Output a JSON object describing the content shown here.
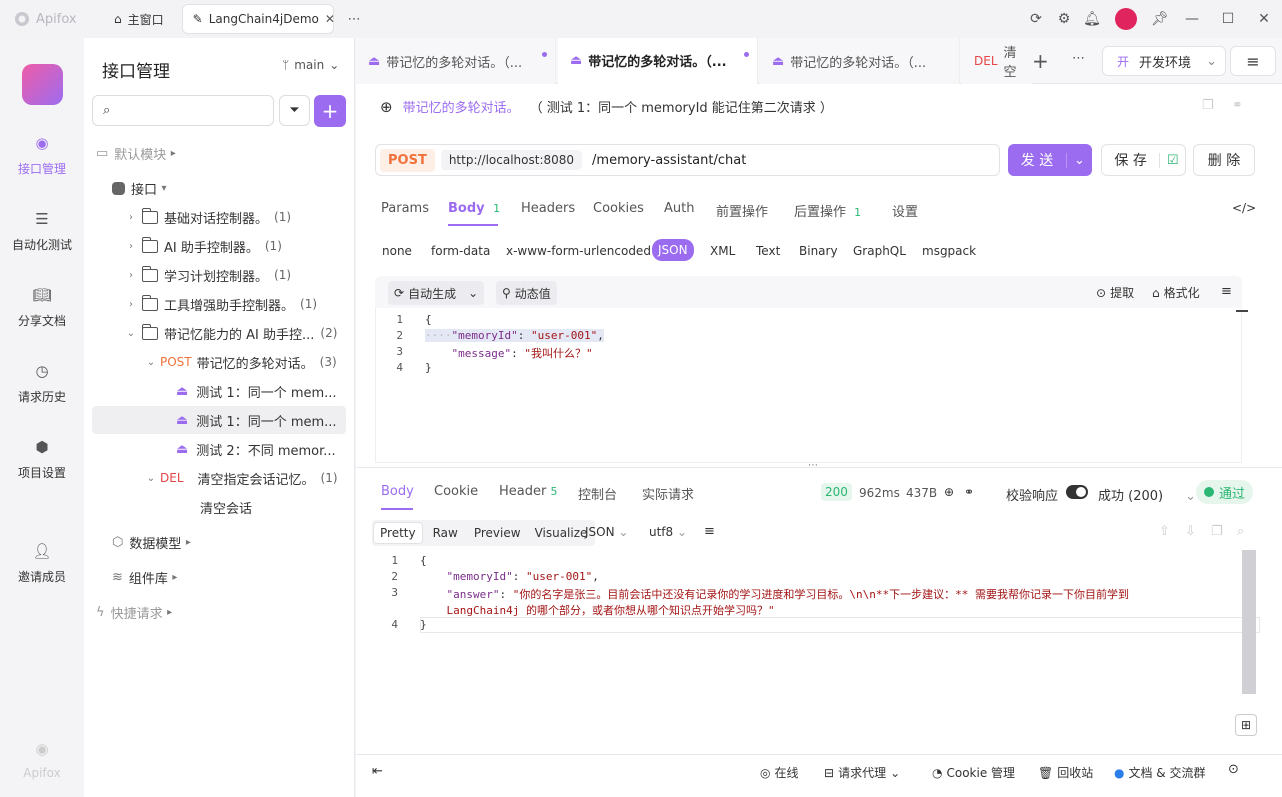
{
  "app": {
    "name": "Apifox",
    "logo_icon": "apifox-logo-icon"
  },
  "window_tabs": [
    {
      "label": "主窗口",
      "icon": "home-icon"
    },
    {
      "label": "LangChain4jDemo",
      "icon": "edit-icon"
    }
  ],
  "rail": [
    {
      "label": "接口管理",
      "icon": "api-management-icon",
      "active": true
    },
    {
      "label": "自动化测试",
      "icon": "automation-icon"
    },
    {
      "label": "分享文档",
      "icon": "book-icon"
    },
    {
      "label": "请求历史",
      "icon": "clock-icon"
    },
    {
      "label": "项目设置",
      "icon": "settings-icon"
    },
    {
      "label": "邀请成员",
      "icon": "user-plus-icon"
    }
  ],
  "rail_footer": "Apifox",
  "sidebar": {
    "title": "接口管理",
    "branch": "main",
    "default_module": "默认模块",
    "root": "接口",
    "controllers": [
      {
        "label": "基础对话控制器。",
        "count": "(1)"
      },
      {
        "label": "AI 助手控制器。",
        "count": "(1)"
      },
      {
        "label": "学习计划控制器。",
        "count": "(1)"
      },
      {
        "label": "工具增强助手控制器。",
        "count": "(1)"
      },
      {
        "label": "带记忆能力的 AI 助手控...",
        "count": "(2)"
      }
    ],
    "post_endpoint": {
      "method": "POST",
      "label": "带记忆的多轮对话。",
      "count": "(3)"
    },
    "cases": [
      "测试 1：同一个 mem...",
      "测试 1：同一个 mem...",
      "测试 2：不同 memor..."
    ],
    "del_endpoint": {
      "method": "DEL",
      "label": "清空指定会话记忆。",
      "count": "(1)"
    },
    "del_case": "清空会话",
    "data_model": "数据模型",
    "components": "组件库",
    "quick_request": "快捷请求"
  },
  "tabs": [
    {
      "label": "带记忆的多轮对话。（..."
    },
    {
      "label": "带记忆的多轮对话。（..."
    },
    {
      "label": "带记忆的多轮对话。（..."
    },
    {
      "method": "DEL",
      "label": "清空"
    }
  ],
  "env": {
    "badge": "开",
    "label": "开发环境"
  },
  "request": {
    "title": "带记忆的多轮对话。",
    "subtitle": "（ 测试 1：同一个 memoryId 能记住第二次请求 ）",
    "method": "POST",
    "base_url": "http://localhost:8080",
    "path": "/memory-assistant/chat",
    "send": "发 送",
    "save": "保 存",
    "delete": "删 除"
  },
  "param_tabs": [
    {
      "label": "Params"
    },
    {
      "label": "Body",
      "badge": "1"
    },
    {
      "label": "Headers"
    },
    {
      "label": "Cookies"
    },
    {
      "label": "Auth"
    },
    {
      "label": "前置操作"
    },
    {
      "label": "后置操作",
      "badge": "1"
    },
    {
      "label": "设置"
    }
  ],
  "body_types": [
    "none",
    "form-data",
    "x-www-form-urlencoded",
    "JSON",
    "XML",
    "Text",
    "Binary",
    "GraphQL",
    "msgpack"
  ],
  "body_tools": {
    "auto_gen": "自动生成",
    "dynamic": "动态值",
    "extract": "提取",
    "format": "格式化"
  },
  "request_body": {
    "lines": [
      "1",
      "2",
      "3",
      "4"
    ],
    "l1": "{",
    "l2_key": "\"memoryId\"",
    "l2_val": "\"user-001\"",
    "l3_key": "\"message\"",
    "l3_val": "\"我叫什么？\"",
    "l4": "}"
  },
  "response_tabs": [
    {
      "label": "Body"
    },
    {
      "label": "Cookie"
    },
    {
      "label": "Header",
      "badge": "5"
    },
    {
      "label": "控制台"
    },
    {
      "label": "实际请求"
    }
  ],
  "response_meta": {
    "status": "200",
    "time": "962ms",
    "size": "437B",
    "validate": "校验响应",
    "result": "成功 (200)",
    "pass": "通过"
  },
  "view_modes": [
    "Pretty",
    "Raw",
    "Preview",
    "Visualize"
  ],
  "format_select": "JSON",
  "encoding_select": "utf8",
  "response_body": {
    "lines": [
      "1",
      "2",
      "3",
      "4"
    ],
    "l1": "{",
    "l2_key": "\"memoryId\"",
    "l2_val": "\"user-001\"",
    "l3_key": "\"answer\"",
    "l3_val_a": "\"你的名字是张三。目前会话中还没有记录你的学习进度和学习目标。\\n\\n**下一步建议：** 需要我帮你记录一下你目前学到",
    "l3_val_b": "LangChain4j 的哪个部分，或者你想从哪个知识点开始学习吗？\"",
    "l4": "}"
  },
  "footer": {
    "online": "在线",
    "proxy": "请求代理",
    "cookie": "Cookie 管理",
    "trash": "回收站",
    "docs": "文档 & 交流群"
  },
  "colors": {
    "accent": "#9b6cf0",
    "post": "#f0723a",
    "del": "#e64545",
    "success": "#2bb673"
  }
}
